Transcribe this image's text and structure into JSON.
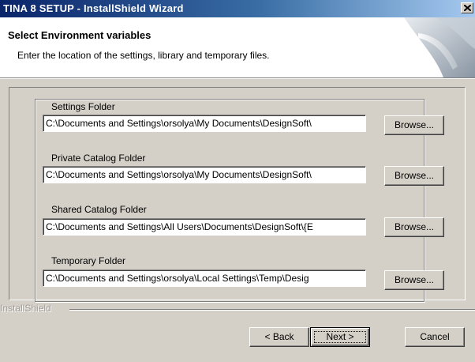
{
  "window": {
    "title": "TINA 8 SETUP - InstallShield Wizard"
  },
  "header": {
    "title": "Select Environment variables",
    "subtitle": "Enter the location of the settings, library and temporary files."
  },
  "folders": [
    {
      "label": "Settings Folder",
      "value": "C:\\Documents and Settings\\orsolya\\My Documents\\DesignSoft\\",
      "button": "Browse..."
    },
    {
      "label": "Private Catalog Folder",
      "value": "C:\\Documents and Settings\\orsolya\\My Documents\\DesignSoft\\",
      "button": "Browse..."
    },
    {
      "label": "Shared Catalog Folder",
      "value": "C:\\Documents and Settings\\All Users\\Documents\\DesignSoft\\{E",
      "button": "Browse..."
    },
    {
      "label": "Temporary Folder",
      "value": "C:\\Documents and Settings\\orsolya\\Local Settings\\Temp\\Desig",
      "button": "Browse..."
    }
  ],
  "footer": {
    "brand": "InstallShield",
    "back_label": "< Back",
    "next_label": "Next >",
    "cancel_label": "Cancel"
  },
  "icons": [
    "close-icon",
    "setup-logo-icon"
  ],
  "colors": {
    "titlebar_start": "#0a246a",
    "titlebar_end": "#a6caf0",
    "dialog_bg": "#d4d0c8"
  }
}
